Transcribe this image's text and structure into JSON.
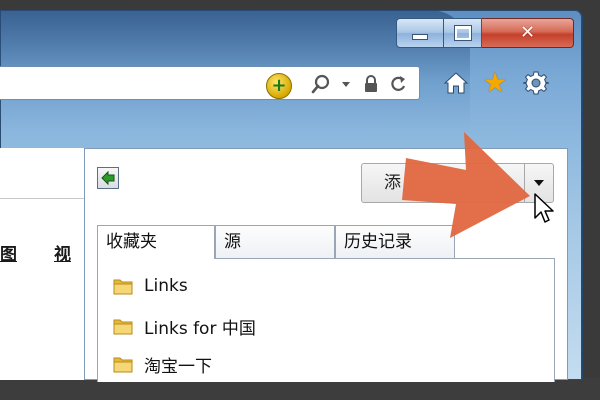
{
  "window": {
    "caption_buttons": [
      "minimize",
      "maximize",
      "close"
    ]
  },
  "address_bar": {
    "icons": [
      "compatibility-icon",
      "search-icon",
      "dropdown-icon",
      "lock-icon",
      "refresh-icon"
    ]
  },
  "toolbar": {
    "icons": [
      "home-icon",
      "star-icon",
      "gear-icon"
    ]
  },
  "page": {
    "links": [
      "图",
      "视"
    ]
  },
  "favorites_panel": {
    "add_button_label": "添",
    "tabs": [
      {
        "label": "收藏夹",
        "selected": true
      },
      {
        "label": "源",
        "selected": false
      },
      {
        "label": "历史记录",
        "selected": false
      }
    ],
    "items": [
      {
        "label": "Links",
        "icon": "folder-icon"
      },
      {
        "label": "Links for 中国",
        "icon": "folder-icon"
      },
      {
        "label": "淘宝一下",
        "icon": "folder-icon"
      }
    ]
  },
  "colors": {
    "accent_arrow": "#e0673f",
    "star": "#f4a800",
    "close_button": "#c4402a",
    "frame_blue": "#7aa9d6"
  }
}
